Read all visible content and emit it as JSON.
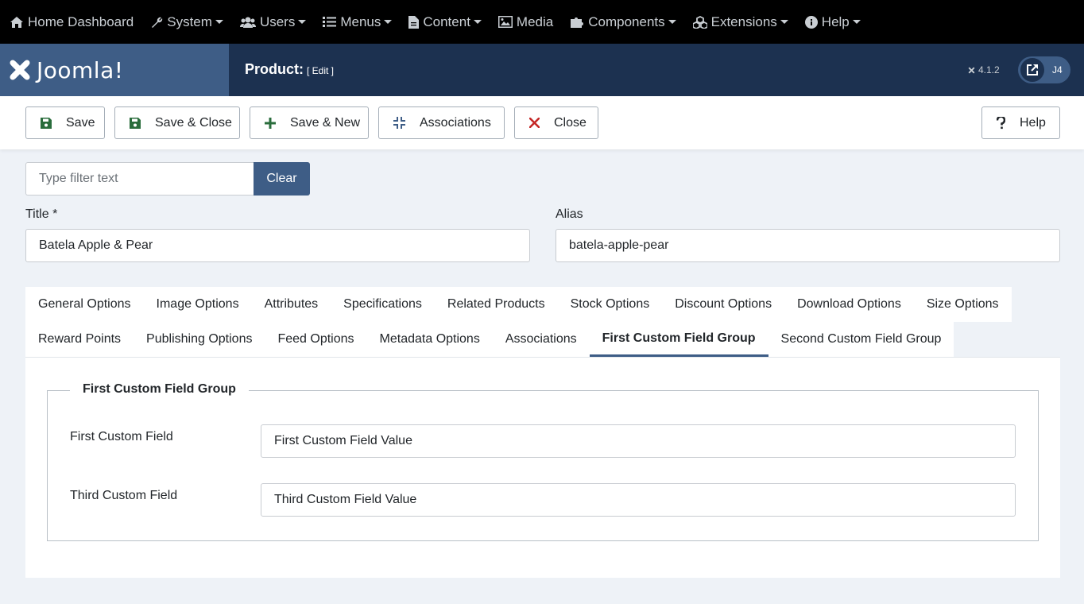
{
  "topnav": {
    "items": [
      {
        "label": "Home Dashboard",
        "icon": "home-icon",
        "dropdown": false
      },
      {
        "label": "System",
        "icon": "wrench-icon",
        "dropdown": true
      },
      {
        "label": "Users",
        "icon": "users-icon",
        "dropdown": true
      },
      {
        "label": "Menus",
        "icon": "list-icon",
        "dropdown": true
      },
      {
        "label": "Content",
        "icon": "file-icon",
        "dropdown": true
      },
      {
        "label": "Media",
        "icon": "image-icon",
        "dropdown": false
      },
      {
        "label": "Components",
        "icon": "puzzle-icon",
        "dropdown": true
      },
      {
        "label": "Extensions",
        "icon": "cubes-icon",
        "dropdown": true
      },
      {
        "label": "Help",
        "icon": "info-icon",
        "dropdown": true
      }
    ]
  },
  "header": {
    "logo": "Joomla!",
    "title": "Product:",
    "subtitle": "[ Edit ]",
    "version": "4.1.2",
    "user_badge": "J4"
  },
  "toolbar": {
    "save": "Save",
    "save_close": "Save & Close",
    "save_new": "Save & New",
    "associations": "Associations",
    "close": "Close",
    "help": "Help"
  },
  "filter": {
    "placeholder": "Type filter text",
    "clear": "Clear"
  },
  "form": {
    "title_label": "Title *",
    "title_value": "Batela Apple & Pear",
    "alias_label": "Alias",
    "alias_value": "batela-apple-pear"
  },
  "tabs": {
    "row1": [
      "General Options",
      "Image Options",
      "Attributes",
      "Specifications",
      "Related Products",
      "Stock Options",
      "Discount Options",
      "Download Options",
      "Size Options"
    ],
    "row2": [
      "Reward Points",
      "Publishing Options",
      "Feed Options",
      "Metadata Options",
      "Associations",
      "First Custom Field Group",
      "Second Custom Field Group"
    ],
    "active": "First Custom Field Group"
  },
  "panel": {
    "legend": "First Custom Field Group",
    "field1_label": "First Custom Field",
    "field1_value": "First Custom Field Value",
    "field2_label": "Third Custom Field",
    "field2_value": "Third Custom Field Value"
  },
  "colors": {
    "nav_bg": "#000000",
    "header_bg": "#1c3150",
    "logo_bg": "#3e5d86",
    "accent": "#3e5d86",
    "save_icon": "#2a6d3c",
    "close_icon": "#c52827"
  }
}
